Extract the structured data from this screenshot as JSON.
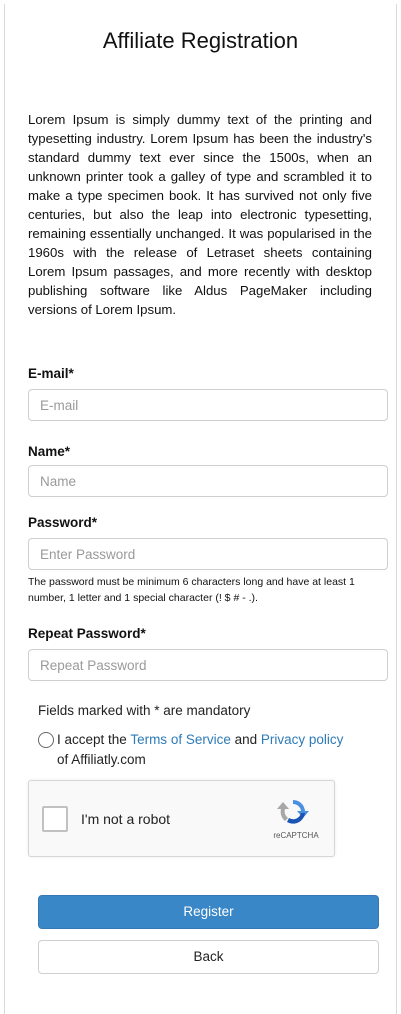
{
  "page": {
    "title": "Affiliate Registration",
    "intro": "Lorem Ipsum is simply dummy text of the printing and typesetting industry. Lorem Ipsum has been the industry's standard dummy text ever since the 1500s, when an unknown printer took a galley of type and scrambled it to make a type specimen book. It has survived not only five centuries, but also the leap into electronic typesetting, remaining essentially unchanged. It was popularised in the 1960s with the release of Letraset sheets containing Lorem Ipsum passages, and more recently with desktop publishing software like Aldus PageMaker including versions of Lorem Ipsum."
  },
  "form": {
    "email": {
      "label": "E-mail*",
      "placeholder": "E-mail",
      "value": ""
    },
    "name": {
      "label": "Name*",
      "placeholder": "Name",
      "value": ""
    },
    "password": {
      "label": "Password*",
      "placeholder": "Enter Password",
      "value": "",
      "hint": "The password must be minimum 6 characters long and have at least 1 number, 1 letter and 1 special character (! $ # - .)."
    },
    "repeat_password": {
      "label": "Repeat Password*",
      "placeholder": "Repeat Password",
      "value": ""
    },
    "mandatory_note": "Fields marked with * are mandatory",
    "terms": {
      "prefix": "I accept the",
      "terms_link": "Terms of Service",
      "and": "and",
      "privacy_link": "Privacy policy",
      "suffix": "of Affiliatly.com",
      "checked": false
    },
    "captcha": {
      "label": "I'm not a robot",
      "brand": "reCAPTCHA"
    },
    "register_label": "Register",
    "back_label": "Back"
  },
  "colors": {
    "primary": "#3a87c8",
    "link": "#2d7bb8",
    "border": "#cfcfcf"
  }
}
